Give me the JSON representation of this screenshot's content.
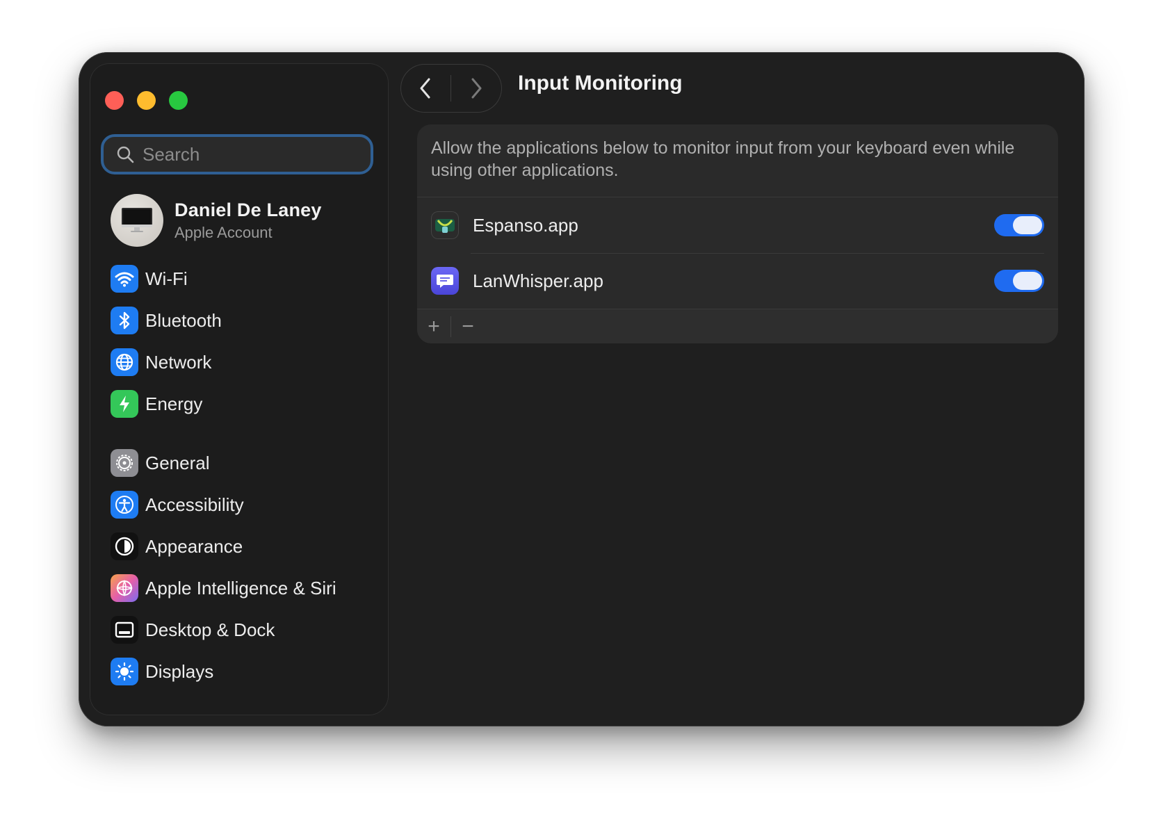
{
  "window": {
    "traffic_lights": [
      "close",
      "minimize",
      "zoom"
    ]
  },
  "search": {
    "placeholder": "Search"
  },
  "account": {
    "name": "Daniel De Laney",
    "subtitle": "Apple Account"
  },
  "sidebar": {
    "items": [
      {
        "label": "Wi-Fi",
        "icon": "wifi-icon",
        "color": "#1e7cf2"
      },
      {
        "label": "Bluetooth",
        "icon": "bluetooth-icon",
        "color": "#1e7cf2"
      },
      {
        "label": "Network",
        "icon": "globe-icon",
        "color": "#1e7cf2"
      },
      {
        "label": "Energy",
        "icon": "bolt-icon",
        "color": "#34c759"
      },
      {
        "label": "General",
        "icon": "gear-icon",
        "color": "#8e8e93"
      },
      {
        "label": "Accessibility",
        "icon": "accessibility-icon",
        "color": "#1e7cf2"
      },
      {
        "label": "Appearance",
        "icon": "appearance-icon",
        "color": "#1a1a1a"
      },
      {
        "label": "Apple Intelligence & Siri",
        "icon": "siri-icon",
        "color": "#e66fb5"
      },
      {
        "label": "Desktop & Dock",
        "icon": "dock-icon",
        "color": "#1a1a1a"
      },
      {
        "label": "Displays",
        "icon": "sun-icon",
        "color": "#1e7cf2"
      }
    ]
  },
  "toolbar": {
    "title": "Input Monitoring"
  },
  "content": {
    "description": "Allow the applications below to monitor input from your keyboard even while using other applications.",
    "apps": [
      {
        "name": "Espanso.app",
        "enabled": true,
        "icon": "espanso-icon"
      },
      {
        "name": "LanWhisper.app",
        "enabled": true,
        "icon": "lanwhisper-icon"
      }
    ],
    "add_symbol": "+",
    "remove_symbol": "−"
  },
  "colors": {
    "accent": "#1f6bf0",
    "focus_ring": "#2f5f93"
  }
}
